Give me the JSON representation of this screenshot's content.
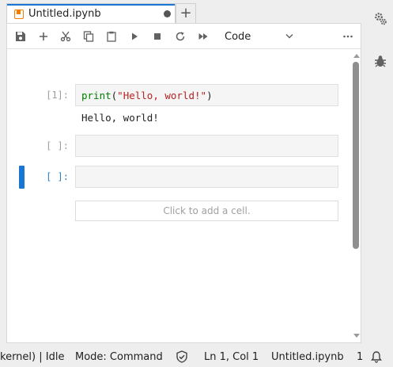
{
  "tab": {
    "title": "Untitled.ipynb",
    "icon": "notebook-icon",
    "dirty_indicator": "unsaved-dot",
    "add_tab_label": "+"
  },
  "toolbar": {
    "buttons": [
      "save",
      "insert-cell",
      "cut",
      "copy",
      "paste",
      "run",
      "interrupt",
      "restart",
      "restart-run-all"
    ],
    "cell_type": "Code",
    "more": "..."
  },
  "cells": [
    {
      "prompt": "[1]:",
      "code": {
        "fn": "print",
        "open": "(",
        "str": "\"Hello, world!\"",
        "close": ")"
      },
      "output": "Hello, world!"
    },
    {
      "prompt": "[ ]:"
    },
    {
      "prompt": "[ ]:"
    }
  ],
  "add_cell_placeholder": "Click to add a cell.",
  "status": {
    "kernel": "kernel) | Idle",
    "mode": "Mode: Command",
    "position": "Ln 1, Col 1",
    "file": "Untitled.ipynb",
    "notifications": "1"
  },
  "colors": {
    "accent": "#1976d2",
    "notebook_icon": "#f57c00"
  }
}
